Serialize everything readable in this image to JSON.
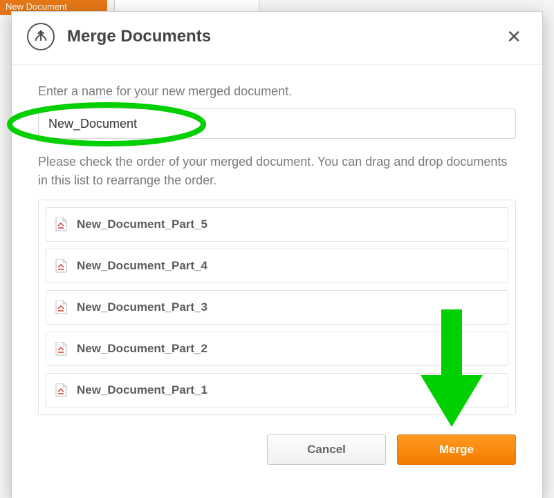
{
  "colors": {
    "annotation_green": "#00d000",
    "primary_orange_top": "#ff9a1f",
    "primary_orange_bottom": "#f07c00"
  },
  "background": {
    "new_document_label": "New Document"
  },
  "modal": {
    "title": "Merge Documents",
    "prompt": "Enter a name for your new merged document.",
    "name_value": "New_Document",
    "order_instruction": "Please check the order of your merged document. You can drag and drop documents in this list to rearrange the order.",
    "items": [
      "New_Document_Part_5",
      "New_Document_Part_4",
      "New_Document_Part_3",
      "New_Document_Part_2",
      "New_Document_Part_1"
    ],
    "buttons": {
      "cancel": "Cancel",
      "merge": "Merge"
    }
  }
}
